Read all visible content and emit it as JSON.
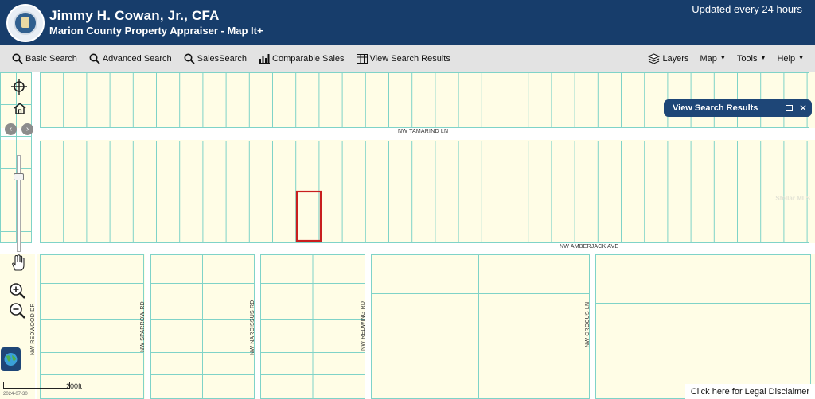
{
  "header": {
    "name": "Jimmy H. Cowan, Jr., CFA",
    "subtitle": "Marion County Property Appraiser - Map It+",
    "update_note": "Updated every 24 hours"
  },
  "toolbar": {
    "basic_search": "Basic Search",
    "advanced_search": "Advanced Search",
    "sales_search": "SalesSearch",
    "comparable_sales": "Comparable Sales",
    "view_search_results": "View Search Results",
    "layers": "Layers",
    "map": "Map",
    "tools": "Tools",
    "help": "Help"
  },
  "map": {
    "roads": {
      "tamarind": "NW TAMARIND LN",
      "amberjack": "NW AMBERJACK AVE",
      "redwood": "NW REDWOOD DR",
      "sparrow": "NW SPARROW RD",
      "narcissus": "NW NARCISSUS RD",
      "redwing": "NW REDWING RD",
      "crocus": "NW CROCUS LN"
    },
    "scale_label": "200ft",
    "date_stamp": "2024-07-30",
    "watermark": "Stellar MLS",
    "colors": {
      "parcel_fill": "#fffde6",
      "parcel_line": "#7fd3c8",
      "road": "#ffffff",
      "highlight": "#c81e1e"
    }
  },
  "panel": {
    "title": "View Search Results"
  },
  "footer": {
    "disclaimer": "Click here for Legal Disclaimer"
  }
}
